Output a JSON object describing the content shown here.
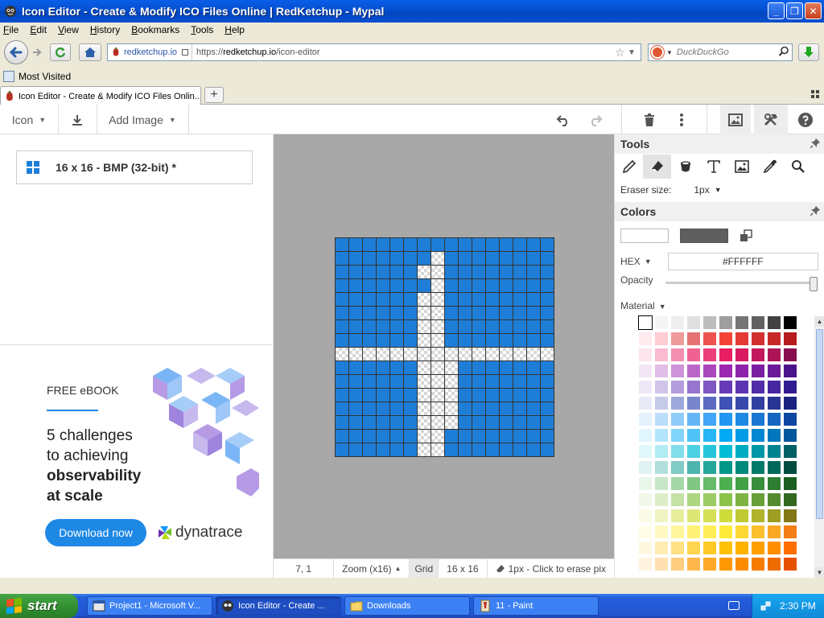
{
  "window": {
    "title": "Icon Editor - Create & Modify ICO Files Online | RedKetchup - Mypal"
  },
  "menu": {
    "items": [
      "File",
      "Edit",
      "View",
      "History",
      "Bookmarks",
      "Tools",
      "Help"
    ]
  },
  "nav": {
    "site": "redketchup.io",
    "url_prefix": "https://",
    "url_domain": "redketchup.io",
    "url_path": "/icon-editor",
    "search_placeholder": "DuckDuckGo"
  },
  "bookmarks": {
    "most_visited": "Most Visited"
  },
  "tab": {
    "title": "Icon Editor - Create & Modify ICO Files Onlin..."
  },
  "toolbar": {
    "icon_label": "Icon",
    "add_image_label": "Add Image"
  },
  "left_panel": {
    "format": "16 x 16 - BMP (32-bit) *"
  },
  "ad": {
    "kicker": "FREE eBOOK",
    "line1": "5 challenges",
    "line2": "to achieving",
    "line3": "observability",
    "line4": "at scale",
    "cta": "Download now",
    "brand": "dynatrace"
  },
  "canvas": {
    "size": 16,
    "fill_color": "#1E7ED7",
    "transparent_pixels": [
      [
        7,
        1
      ],
      [
        7,
        2
      ],
      [
        6,
        2
      ],
      [
        7,
        3
      ],
      [
        7,
        4
      ],
      [
        6,
        4
      ],
      [
        7,
        5
      ],
      [
        6,
        5
      ],
      [
        7,
        6
      ],
      [
        6,
        6
      ],
      [
        7,
        7
      ],
      [
        6,
        7
      ],
      [
        7,
        8
      ],
      [
        6,
        8
      ],
      [
        7,
        9
      ],
      [
        6,
        9
      ],
      [
        7,
        10
      ],
      [
        6,
        10
      ],
      [
        7,
        11
      ],
      [
        6,
        11
      ],
      [
        7,
        12
      ],
      [
        6,
        12
      ],
      [
        7,
        13
      ],
      [
        6,
        13
      ],
      [
        7,
        14
      ],
      [
        6,
        14
      ],
      [
        7,
        15
      ],
      [
        6,
        15
      ],
      [
        8,
        9
      ],
      [
        8,
        10
      ],
      [
        8,
        11
      ],
      [
        8,
        12
      ],
      [
        8,
        13
      ],
      [
        0,
        8
      ],
      [
        1,
        8
      ],
      [
        2,
        8
      ],
      [
        3,
        8
      ],
      [
        4,
        8
      ],
      [
        5,
        8
      ],
      [
        6,
        8
      ],
      [
        7,
        8
      ],
      [
        8,
        8
      ],
      [
        9,
        8
      ],
      [
        10,
        8
      ],
      [
        11,
        8
      ],
      [
        12,
        8
      ],
      [
        13,
        8
      ],
      [
        14,
        8
      ],
      [
        15,
        8
      ]
    ]
  },
  "status": {
    "coords": "7, 1",
    "zoom": "Zoom (x16)",
    "grid": "Grid",
    "size": "16 x 16",
    "hint": "1px - Click to erase pix"
  },
  "tools_panel": {
    "title": "Tools",
    "eraser_label": "Eraser size:",
    "eraser_value": "1px"
  },
  "colors_panel": {
    "title": "Colors",
    "primary": "#FFFFFF",
    "secondary": "#5F5F5F",
    "hex_label": "HEX",
    "hex_value": "#FFFFFF",
    "opacity_label": "Opacity",
    "opacity": 1.0,
    "material_label": "Material",
    "palette": [
      [
        "#FFFFFF",
        "#F5F5F5",
        "#EEEEEE",
        "#E0E0E0",
        "#BDBDBD",
        "#9E9E9E",
        "#757575",
        "#616161",
        "#424242",
        "#000000"
      ],
      [
        "#FFEBEE",
        "#FFCDD2",
        "#EF9A9A",
        "#E57373",
        "#EF5350",
        "#F44336",
        "#E53935",
        "#D32F2F",
        "#C62828",
        "#B71C1C"
      ],
      [
        "#FCE4EC",
        "#F8BBD0",
        "#F48FB1",
        "#F06292",
        "#EC407A",
        "#E91E63",
        "#D81B60",
        "#C2185B",
        "#AD1457",
        "#880E4F"
      ],
      [
        "#F3E5F5",
        "#E1BEE7",
        "#CE93D8",
        "#BA68C8",
        "#AB47BC",
        "#9C27B0",
        "#8E24AA",
        "#7B1FA2",
        "#6A1B9A",
        "#4A148C"
      ],
      [
        "#EDE7F6",
        "#D1C4E9",
        "#B39DDB",
        "#9575CD",
        "#7E57C2",
        "#673AB7",
        "#5E35B1",
        "#512DA8",
        "#4527A0",
        "#311B92"
      ],
      [
        "#E8EAF6",
        "#C5CAE9",
        "#9FA8DA",
        "#7986CB",
        "#5C6BC0",
        "#3F51B5",
        "#3949AB",
        "#303F9F",
        "#283593",
        "#1A237E"
      ],
      [
        "#E3F2FD",
        "#BBDEFB",
        "#90CAF9",
        "#64B5F6",
        "#42A5F5",
        "#2196F3",
        "#1E88E5",
        "#1976D2",
        "#1565C0",
        "#0D47A1"
      ],
      [
        "#E1F5FE",
        "#B3E5FC",
        "#81D4FA",
        "#4FC3F7",
        "#29B6F6",
        "#03A9F4",
        "#039BE5",
        "#0288D1",
        "#0277BD",
        "#01579B"
      ],
      [
        "#E0F7FA",
        "#B2EBF2",
        "#80DEEA",
        "#4DD0E1",
        "#26C6DA",
        "#00BCD4",
        "#00ACC1",
        "#0097A7",
        "#00838F",
        "#006064"
      ],
      [
        "#E0F2F1",
        "#B2DFDB",
        "#80CBC4",
        "#4DB6AC",
        "#26A69A",
        "#009688",
        "#00897B",
        "#00796B",
        "#00695C",
        "#004D40"
      ],
      [
        "#E8F5E9",
        "#C8E6C9",
        "#A5D6A7",
        "#81C784",
        "#66BB6A",
        "#4CAF50",
        "#43A047",
        "#388E3C",
        "#2E7D32",
        "#1B5E20"
      ],
      [
        "#F1F8E9",
        "#DCEDC8",
        "#C5E1A5",
        "#AED581",
        "#9CCC65",
        "#8BC34A",
        "#7CB342",
        "#689F38",
        "#558B2F",
        "#33691E"
      ],
      [
        "#F9FBE7",
        "#F0F4C3",
        "#E6EE9C",
        "#DCE775",
        "#D4E157",
        "#CDDC39",
        "#C0CA33",
        "#AFB42B",
        "#9E9D24",
        "#827717"
      ],
      [
        "#FFFDE7",
        "#FFF9C4",
        "#FFF59D",
        "#FFF176",
        "#FFEE58",
        "#FFEB3B",
        "#FDD835",
        "#FBC02D",
        "#F9A825",
        "#F57F17"
      ],
      [
        "#FFF8E1",
        "#FFECB3",
        "#FFE082",
        "#FFD54F",
        "#FFCA28",
        "#FFC107",
        "#FFB300",
        "#FFA000",
        "#FF8F00",
        "#FF6F00"
      ],
      [
        "#FFF3E0",
        "#FFE0B2",
        "#FFCC80",
        "#FFB74D",
        "#FFA726",
        "#FF9800",
        "#FB8C00",
        "#F57C00",
        "#EF6C00",
        "#E65100"
      ]
    ]
  },
  "taskbar": {
    "start": "start",
    "tasks": [
      {
        "label": "Project1 - Microsoft V..."
      },
      {
        "label": "Icon Editor - Create ..."
      },
      {
        "label": "Downloads"
      },
      {
        "label": "11 - Paint"
      }
    ],
    "clock": "2:30 PM"
  }
}
